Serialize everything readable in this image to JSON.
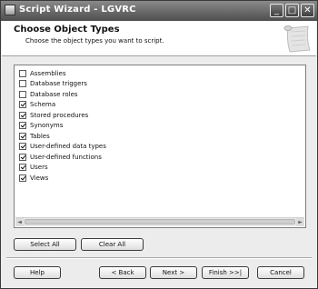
{
  "window": {
    "title": "Script Wizard - LGVRC",
    "minimize_label": "_",
    "maximize_label": "□",
    "close_label": "✕"
  },
  "header": {
    "title": "Choose Object Types",
    "subtitle": "Choose the object types you want to script."
  },
  "object_types": [
    {
      "label": "Assemblies",
      "checked": false
    },
    {
      "label": "Database triggers",
      "checked": false
    },
    {
      "label": "Database roles",
      "checked": false
    },
    {
      "label": "Schema",
      "checked": true
    },
    {
      "label": "Stored procedures",
      "checked": true
    },
    {
      "label": "Synonyms",
      "checked": true
    },
    {
      "label": "Tables",
      "checked": true
    },
    {
      "label": "User-defined data types",
      "checked": true
    },
    {
      "label": "User-defined functions",
      "checked": true
    },
    {
      "label": "Users",
      "checked": true
    },
    {
      "label": "Views",
      "checked": true
    }
  ],
  "scroll": {
    "left_arrow": "◄",
    "right_arrow": "►"
  },
  "selection_buttons": {
    "select_all": "Select All",
    "clear_all": "Clear All"
  },
  "footer": {
    "help": "Help",
    "back": "< Back",
    "next": "Next >",
    "finish": "Finish >>|",
    "cancel": "Cancel"
  }
}
